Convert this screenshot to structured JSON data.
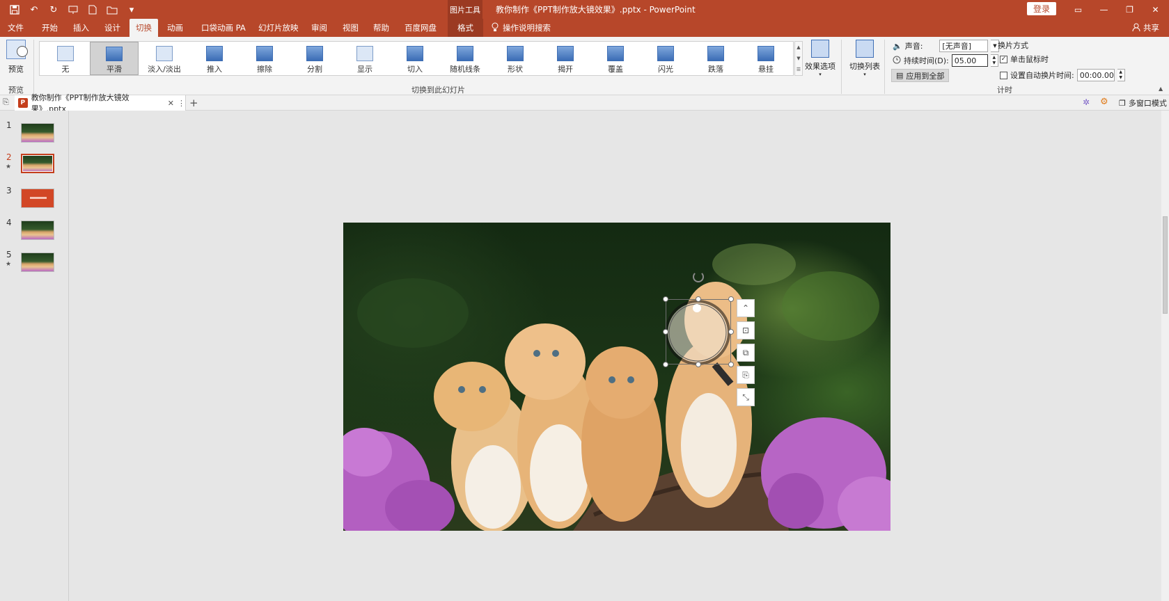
{
  "title_bar": {
    "context_tools": "图片工具",
    "doc_title": "教你制作《PPT制作放大镜效果》.pptx  -  PowerPoint",
    "login": "登录"
  },
  "tabs": [
    {
      "label": "文件"
    },
    {
      "label": "开始"
    },
    {
      "label": "插入"
    },
    {
      "label": "设计"
    },
    {
      "label": "切换"
    },
    {
      "label": "动画"
    },
    {
      "label": "口袋动画 PA"
    },
    {
      "label": "幻灯片放映"
    },
    {
      "label": "审阅"
    },
    {
      "label": "视图"
    },
    {
      "label": "帮助"
    },
    {
      "label": "百度网盘"
    },
    {
      "label": "格式"
    }
  ],
  "tell_me": "操作说明搜索",
  "share": "共享",
  "ribbon": {
    "preview": {
      "button": "预览",
      "group": "预览"
    },
    "transitions": [
      {
        "label": "无"
      },
      {
        "label": "平滑"
      },
      {
        "label": "淡入/淡出"
      },
      {
        "label": "推入"
      },
      {
        "label": "擦除"
      },
      {
        "label": "分割"
      },
      {
        "label": "显示"
      },
      {
        "label": "切入"
      },
      {
        "label": "随机线条"
      },
      {
        "label": "形状"
      },
      {
        "label": "揭开"
      },
      {
        "label": "覆盖"
      },
      {
        "label": "闪光"
      },
      {
        "label": "跌落"
      },
      {
        "label": "悬挂"
      }
    ],
    "selected_transition": "平滑",
    "effect_options": "效果选项",
    "group_transition": "切换到此幻灯片",
    "switch_list": "切换列表",
    "timing": {
      "sound_label": "声音:",
      "sound_value": "[无声音]",
      "duration_label": "持续时间(D):",
      "duration_value": "05.00",
      "apply_all": "应用到全部",
      "advance_title": "换片方式",
      "on_click": "单击鼠标时",
      "after_label": "设置自动换片时间:",
      "after_value": "00:00.00",
      "group": "计时"
    }
  },
  "doc_tab": {
    "name": "教你制作《PPT制作放大镜效果》.pptx",
    "badge": "P"
  },
  "multi_window": "多窗口模式",
  "slides": [
    {
      "num": "1",
      "star": ""
    },
    {
      "num": "2",
      "star": "★"
    },
    {
      "num": "3",
      "star": ""
    },
    {
      "num": "4",
      "star": ""
    },
    {
      "num": "5",
      "star": "★"
    }
  ],
  "colors": {
    "accent": "#b7472a",
    "selected_slide": "#c43e1c"
  }
}
